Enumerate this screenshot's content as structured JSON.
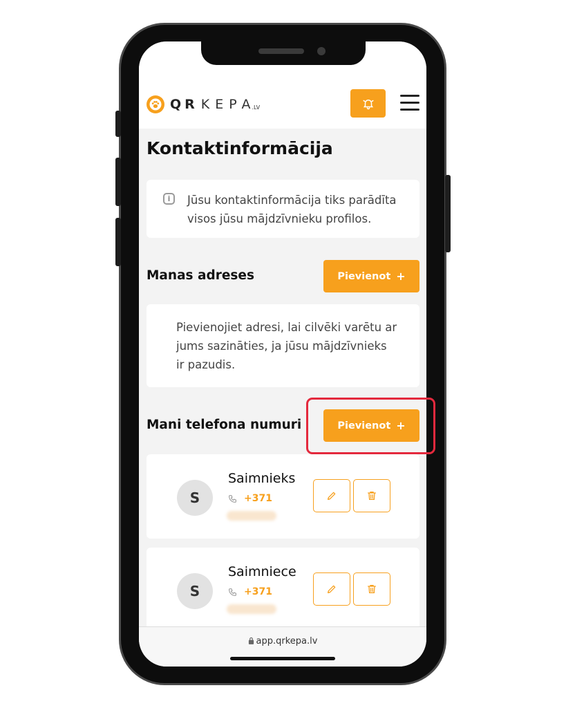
{
  "header": {
    "logo_qr": "QR",
    "logo_kepa": "KEPA",
    "logo_lv": ".LV",
    "bell_icon": "bell-icon",
    "menu_icon": "hamburger-menu-icon"
  },
  "page": {
    "title": "Kontaktinformācija",
    "info_text": "Jūsu kontaktinformācija tiks parādīta visos jūsu mājdzīvnieku profilos."
  },
  "addresses": {
    "title": "Manas adreses",
    "add_label": "Pievienot",
    "add_plus": "+",
    "empty_text": "Pievienojiet adresi, lai cilvēki varētu ar jums sazināties, ja jūsu mājdzīvnieks ir pazudis."
  },
  "phones": {
    "title": "Mani telefona numuri",
    "add_label": "Pievienot",
    "add_plus": "+",
    "items": [
      {
        "initial": "S",
        "name": "Saimnieks",
        "number": "+371"
      },
      {
        "initial": "S",
        "name": "Saimniece",
        "number": "+371"
      }
    ]
  },
  "browser": {
    "url": "app.qrkepa.lv"
  },
  "colors": {
    "accent": "#f7a01d",
    "highlight": "#e4293d"
  }
}
